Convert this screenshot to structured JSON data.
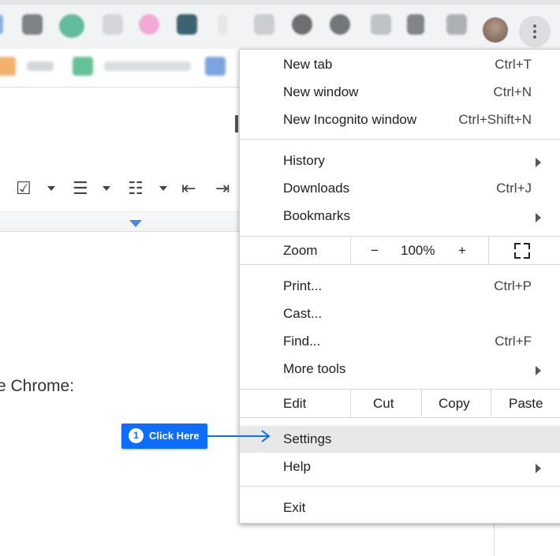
{
  "toolbar": {
    "extension_icons": [
      "ext-icon-1",
      "ext-icon-2",
      "ext-icon-3",
      "ext-icon-4",
      "ext-icon-5",
      "ext-icon-6",
      "ext-icon-7",
      "ext-icon-8",
      "ext-icon-9",
      "ext-icon-10",
      "ext-icon-11",
      "ext-icon-12",
      "ext-icon-13",
      "ext-icon-14"
    ],
    "menu_icon": "three-dots-vertical-icon"
  },
  "document": {
    "visible_text": "e Chrome:"
  },
  "menu": {
    "group1": [
      {
        "label": "New tab",
        "shortcut": "Ctrl+T"
      },
      {
        "label": "New window",
        "shortcut": "Ctrl+N"
      },
      {
        "label": "New Incognito window",
        "shortcut": "Ctrl+Shift+N"
      }
    ],
    "group2": [
      {
        "label": "History",
        "shortcut": ""
      },
      {
        "label": "Downloads",
        "shortcut": "Ctrl+J"
      },
      {
        "label": "Bookmarks",
        "shortcut": ""
      }
    ],
    "zoom": {
      "label": "Zoom",
      "minus": "−",
      "value": "100%",
      "plus": "+"
    },
    "group3": [
      {
        "label": "Print...",
        "shortcut": "Ctrl+P"
      },
      {
        "label": "Cast...",
        "shortcut": ""
      },
      {
        "label": "Find...",
        "shortcut": "Ctrl+F"
      },
      {
        "label": "More tools",
        "shortcut": ""
      }
    ],
    "edit": {
      "label": "Edit",
      "cut": "Cut",
      "copy": "Copy",
      "paste": "Paste"
    },
    "settings": "Settings",
    "help": "Help",
    "exit": "Exit"
  },
  "annotation": {
    "step": "1",
    "text": "Click Here",
    "color": "#0d6efd"
  }
}
